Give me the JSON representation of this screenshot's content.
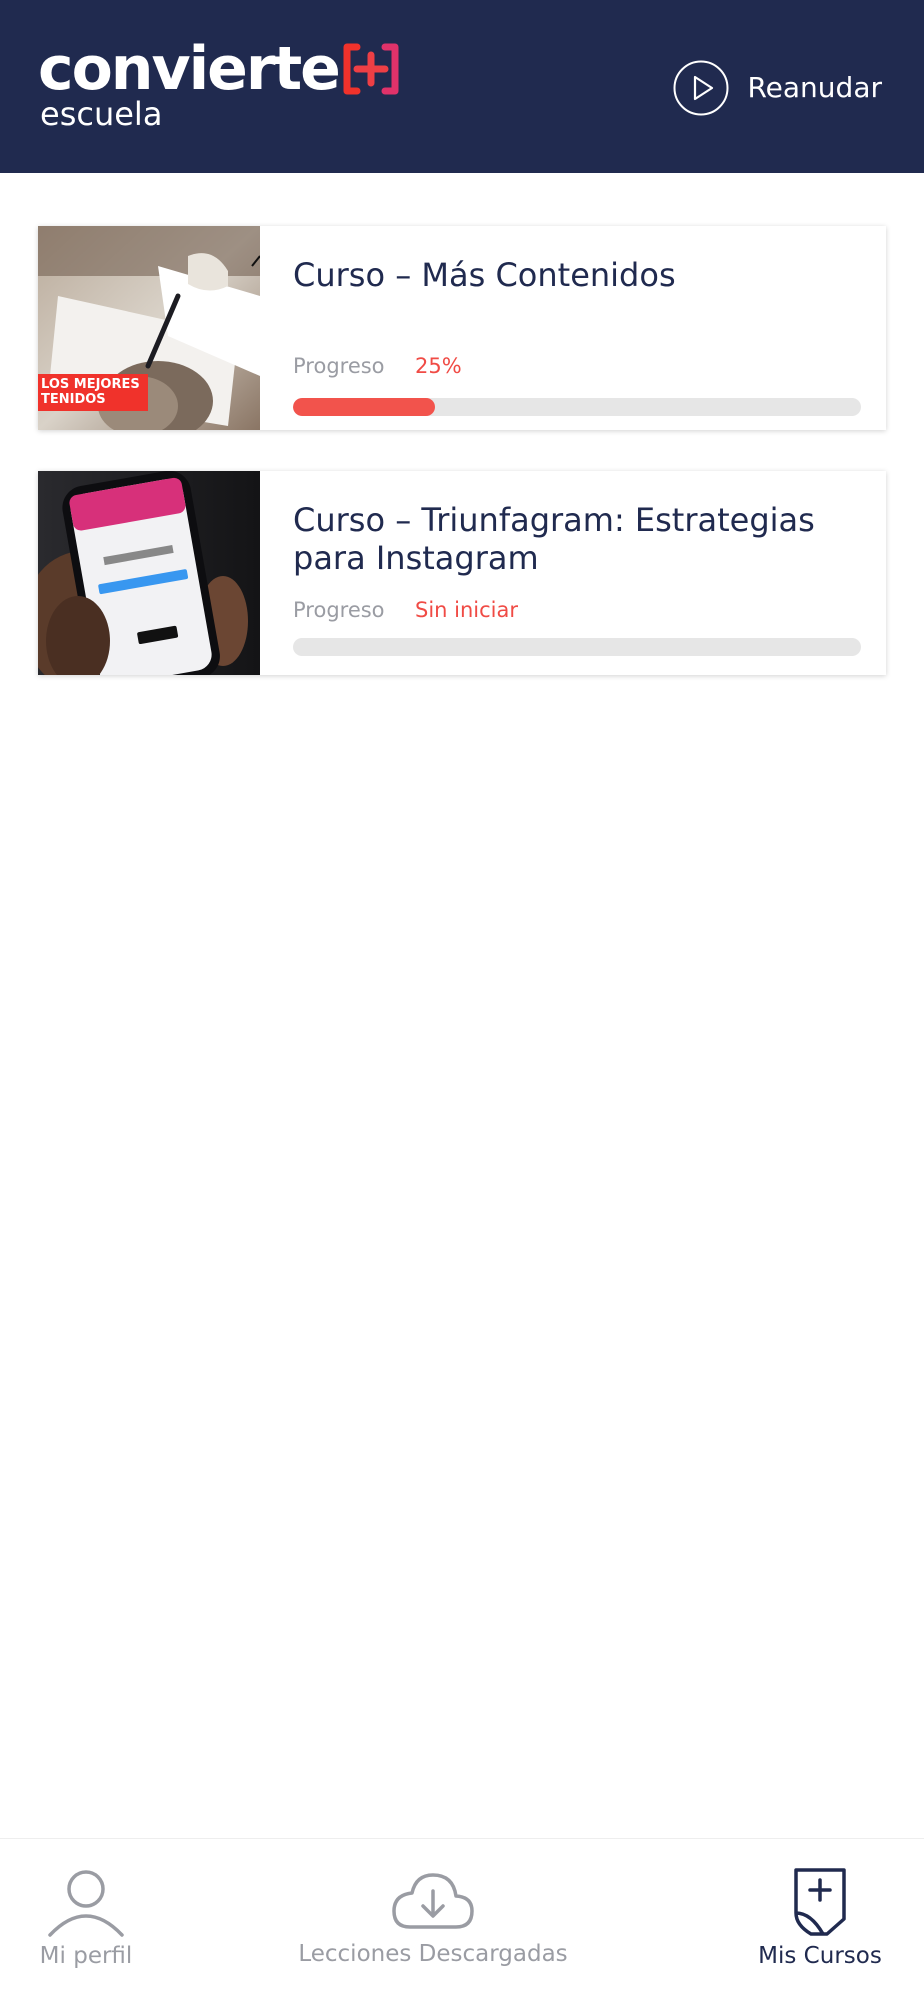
{
  "header": {
    "logo_main": "convierte",
    "logo_sub": "escuela",
    "resume_label": "Reanudar"
  },
  "courses": [
    {
      "title": "Curso – Más Contenidos",
      "thumbnail_badge": "LOS MEJORES\nTENIDOS",
      "progress_label": "Progreso",
      "progress_text": "25%",
      "progress_fraction": 0.25
    },
    {
      "title": "Curso – Triunfagram: Estrategias para Instagram",
      "progress_label": "Progreso",
      "progress_text": "Sin iniciar",
      "progress_fraction": 0
    }
  ],
  "bottom_nav": {
    "items": [
      {
        "label": "Mi perfil",
        "icon": "user-icon",
        "active": false
      },
      {
        "label": "Lecciones Descargadas",
        "icon": "cloud-download-icon",
        "active": false
      },
      {
        "label": "Mis Cursos",
        "icon": "document-plus-icon",
        "active": true
      }
    ]
  },
  "colors": {
    "header_bg": "#202a4f",
    "accent": "#f2534c",
    "muted_text": "#9a9ca3"
  }
}
